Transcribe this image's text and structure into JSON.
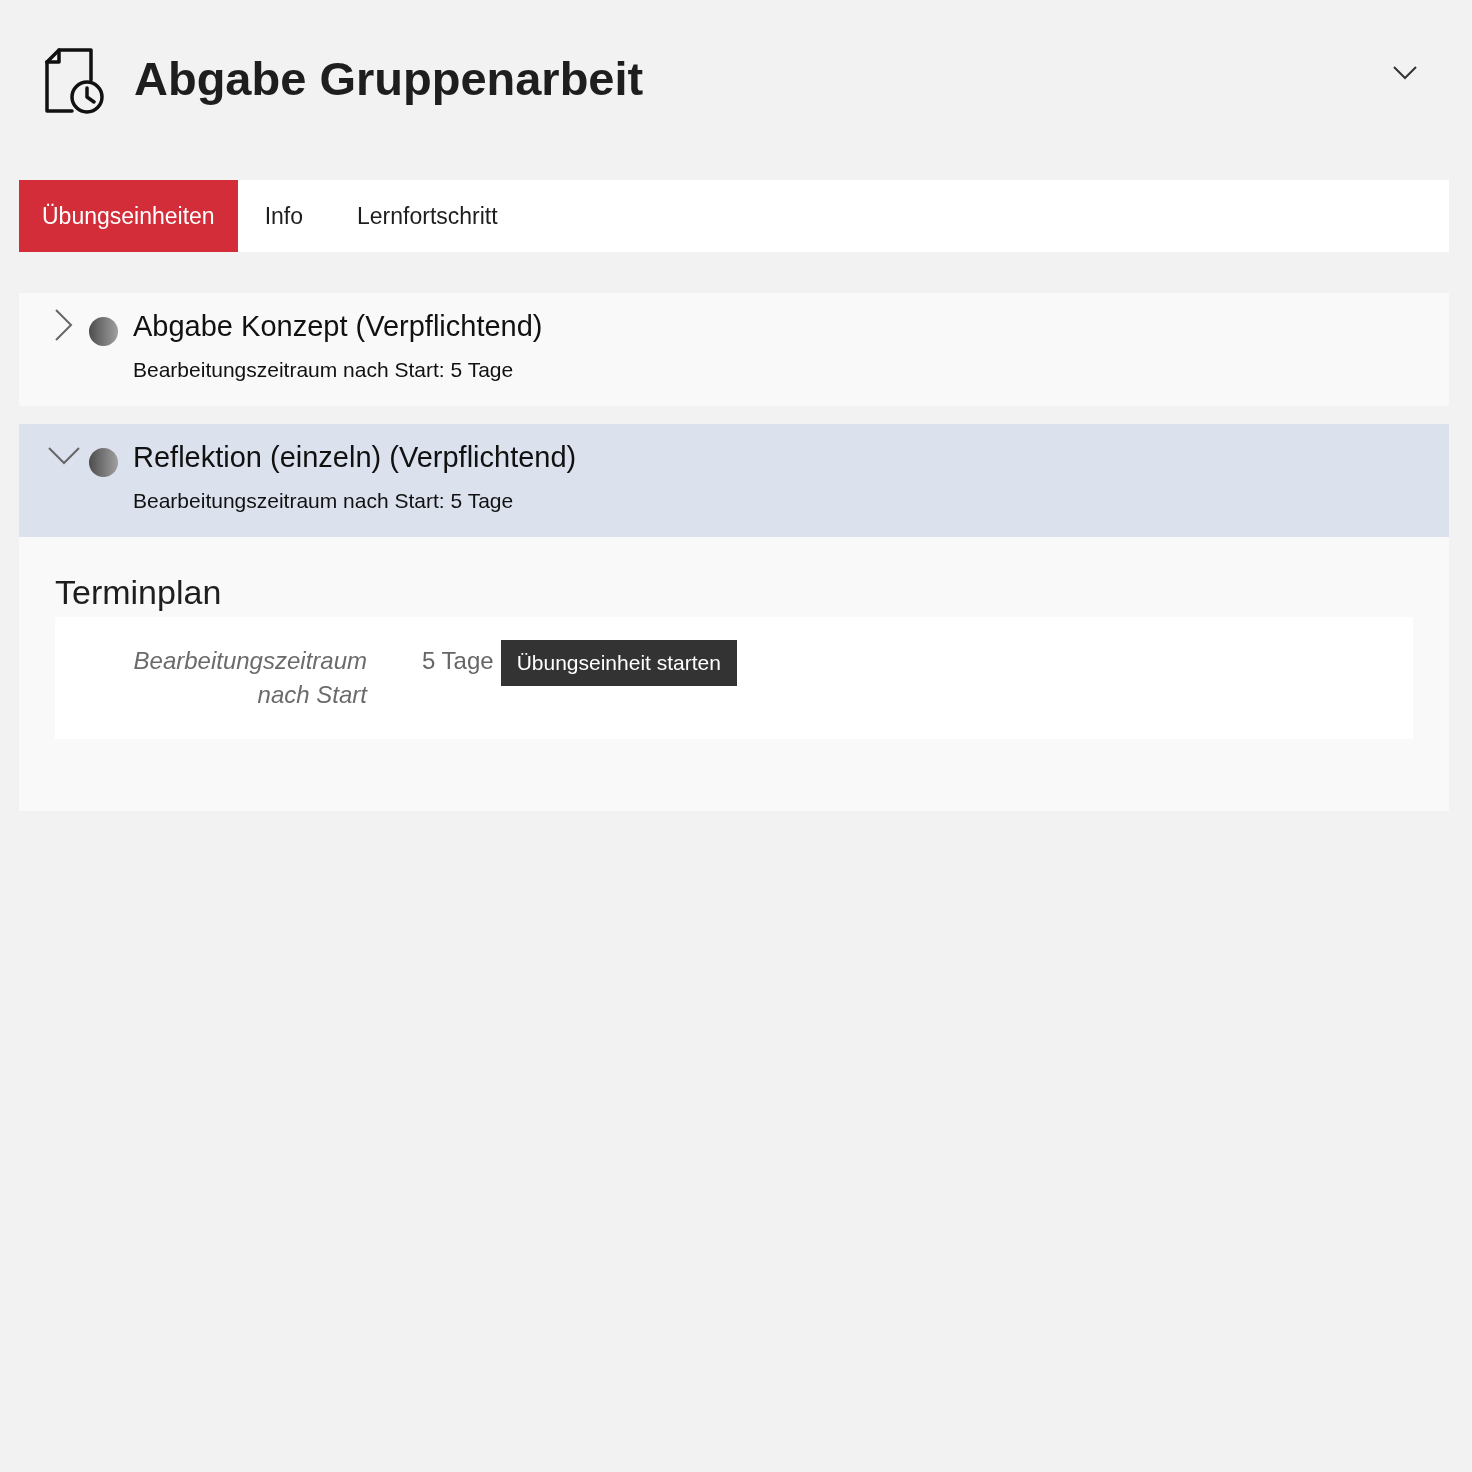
{
  "header": {
    "title": "Abgabe Gruppenarbeit"
  },
  "tabs": [
    {
      "label": "Übungseinheiten",
      "selected": true
    },
    {
      "label": "Info",
      "selected": false
    },
    {
      "label": "Lernfortschritt",
      "selected": false
    }
  ],
  "units": [
    {
      "title": "Abgabe Konzept (Verpflichtend)",
      "subtitle": "Bearbeitungszeitraum nach Start: 5 Tage",
      "expanded": false
    },
    {
      "title": "Reflektion (einzeln) (Verpflichtend)",
      "subtitle": "Bearbeitungszeitraum nach Start: 5 Tage",
      "expanded": true,
      "details": {
        "heading": "Terminplan",
        "rows": [
          {
            "label": "Bearbeitungszeitraum nach Start",
            "value": "5 Tage",
            "button": "Übungseinheit starten"
          }
        ]
      }
    }
  ]
}
